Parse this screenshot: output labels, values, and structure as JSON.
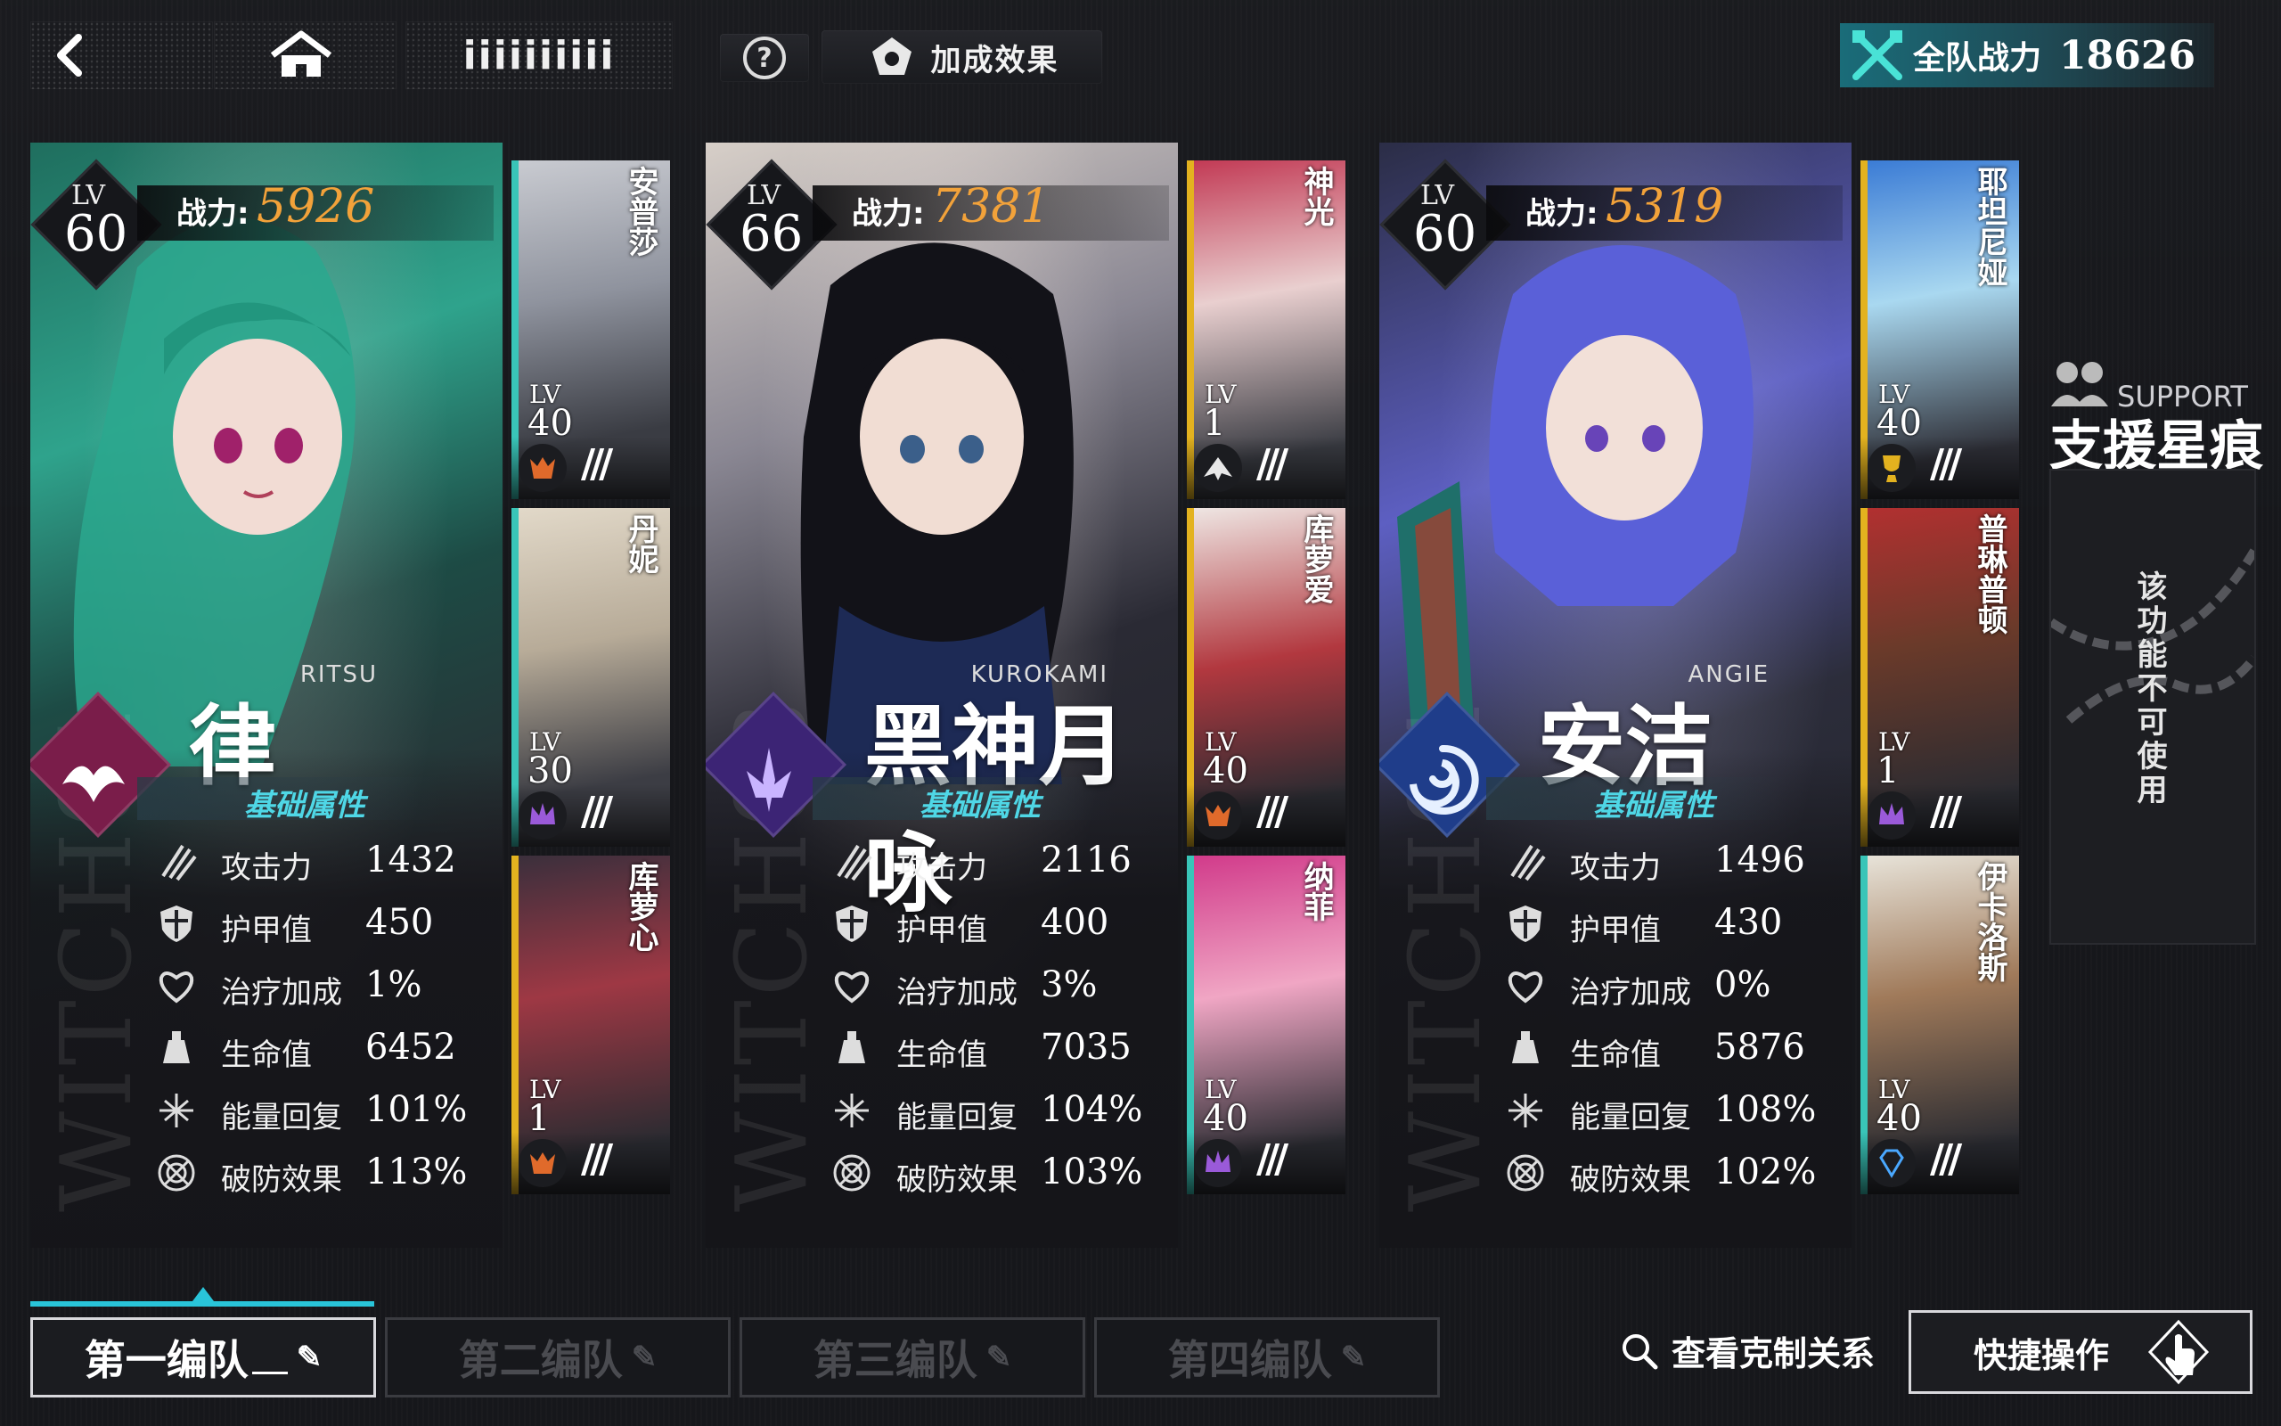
{
  "topbar": {
    "back_icon": "back-arrow-icon",
    "home_icon": "home-icon",
    "menu_glyph": "iiiiiiiiii",
    "help_icon": "question-icon",
    "bonus_label": "加成效果",
    "power_label": "全队战力",
    "power_value": "18626"
  },
  "teams": [
    {
      "lv_label": "LV",
      "lv": "60",
      "cp_label": "战力:",
      "cp": "5926",
      "name_roman": "RITSU",
      "name_cn": "律",
      "witch": "WITCH01",
      "attr_header": "基础属性",
      "element_color": "#7a1d4a",
      "stats": [
        {
          "label": "攻击力",
          "value": "1432"
        },
        {
          "label": "护甲值",
          "value": "450"
        },
        {
          "label": "治疗加成",
          "value": "1%"
        },
        {
          "label": "生命值",
          "value": "6452"
        },
        {
          "label": "能量回复",
          "value": "101%"
        },
        {
          "label": "破防效果",
          "value": "113%"
        }
      ],
      "supports": [
        {
          "name": "安普莎",
          "lv_label": "LV",
          "lv": "40",
          "accent": "#39c5b8"
        },
        {
          "name": "丹妮",
          "lv_label": "LV",
          "lv": "30",
          "accent": "#39c5b8"
        },
        {
          "name": "库萝心",
          "lv_label": "LV",
          "lv": "1",
          "accent": "#e3b21f"
        }
      ]
    },
    {
      "lv_label": "LV",
      "lv": "66",
      "cp_label": "战力:",
      "cp": "7381",
      "name_roman": "KUROKAMI",
      "name_cn": "黑神月咏",
      "witch": "WITCH03",
      "attr_header": "基础属性",
      "element_color": "#3c2475",
      "stats": [
        {
          "label": "攻击力",
          "value": "2116"
        },
        {
          "label": "护甲值",
          "value": "400"
        },
        {
          "label": "治疗加成",
          "value": "3%"
        },
        {
          "label": "生命值",
          "value": "7035"
        },
        {
          "label": "能量回复",
          "value": "104%"
        },
        {
          "label": "破防效果",
          "value": "103%"
        }
      ],
      "supports": [
        {
          "name": "神光",
          "lv_label": "LV",
          "lv": "1",
          "accent": "#e3b21f"
        },
        {
          "name": "库萝爱",
          "lv_label": "LV",
          "lv": "40",
          "accent": "#e3b21f"
        },
        {
          "name": "纳菲",
          "lv_label": "LV",
          "lv": "40",
          "accent": "#39c5b8"
        }
      ]
    },
    {
      "lv_label": "LV",
      "lv": "60",
      "cp_label": "战力:",
      "cp": "5319",
      "name_roman": "ANGIE",
      "name_cn": "安洁",
      "witch": "WITCH04",
      "attr_header": "基础属性",
      "element_color": "#1f3d8a",
      "stats": [
        {
          "label": "攻击力",
          "value": "1496"
        },
        {
          "label": "护甲值",
          "value": "430"
        },
        {
          "label": "治疗加成",
          "value": "0%"
        },
        {
          "label": "生命值",
          "value": "5876"
        },
        {
          "label": "能量回复",
          "value": "108%"
        },
        {
          "label": "破防效果",
          "value": "102%"
        }
      ],
      "supports": [
        {
          "name": "耶坦尼娅",
          "lv_label": "LV",
          "lv": "40",
          "accent": "#e3b21f"
        },
        {
          "name": "普琳普顿",
          "lv_label": "LV",
          "lv": "1",
          "accent": "#e3b21f"
        },
        {
          "name": "伊卡洛斯",
          "lv_label": "LV",
          "lv": "40",
          "accent": "#39c5b8"
        }
      ]
    }
  ],
  "support_panel": {
    "title_en": "SUPPORT",
    "title_cn": "支援星痕",
    "disabled_text": "该功能不可使用"
  },
  "tabs": [
    "第一编队",
    "第二编队",
    "第三编队",
    "第四编队"
  ],
  "counter_link": "查看克制关系",
  "quick_action": "快捷操作"
}
